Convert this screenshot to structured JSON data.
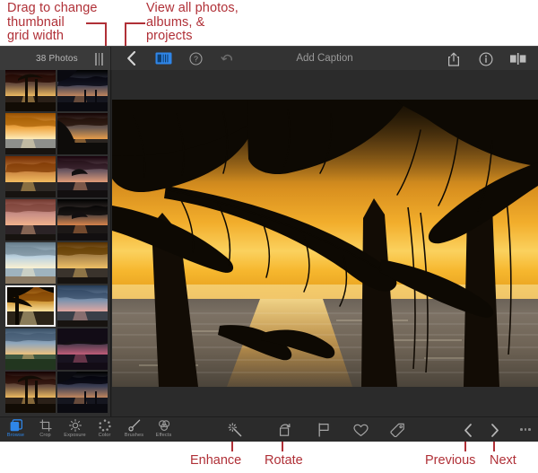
{
  "annotations": {
    "top_left": "Drag to change\nthumbnail\ngrid width",
    "top_mid": "View all photos,\nalbums, &\nprojects",
    "enhance": "Enhance",
    "rotate": "Rotate",
    "previous": "Previous",
    "next": "Next",
    "color": "#b03037"
  },
  "topbar": {
    "photo_count": "38 Photos",
    "grid_handle_name": "grid-width-drag-handle",
    "back_label": "‹",
    "view_all_label": "View All",
    "help_label": "?",
    "undo_label": "Undo",
    "caption_placeholder": "Add Caption",
    "share_label": "Share",
    "info_label": "Info",
    "compare_label": "Compare",
    "accent": "#2f86e8"
  },
  "sidebar": {
    "selected_index": 10,
    "thumbnails": [
      {
        "name": "palms-over-lagoon",
        "sky": "#6d5140",
        "sea": "#2a2018",
        "sun": "#f5c163",
        "kind": "palmshore"
      },
      {
        "name": "beach-silhouette-dusk",
        "sky": "#3b3f55",
        "sea": "#15161f",
        "sun": "#c98a5e",
        "kind": "duskbeach"
      },
      {
        "name": "sunset-over-water-bright",
        "sky": "#f0a845",
        "sea": "#8e8f8b",
        "sun": "#fff0c0",
        "kind": "brightsun"
      },
      {
        "name": "cliffside-sunset",
        "sky": "#6b5a52",
        "sea": "#2a2420",
        "sun": "#f0a24a",
        "kind": "cliff"
      },
      {
        "name": "orange-cloud-bank",
        "sky": "#c8823f",
        "sea": "#2f2a26",
        "sun": "#f6c063",
        "kind": "cloudbank"
      },
      {
        "name": "pink-clouds-horizon",
        "sky": "#6f5a63",
        "sea": "#211d22",
        "sun": "#e8a07a",
        "kind": "pinkcloud"
      },
      {
        "name": "pink-sky-shore",
        "sky": "#c98f86",
        "sea": "#2b2326",
        "sun": "#f3b48c",
        "kind": "pinkshore"
      },
      {
        "name": "dark-cloud-sunset",
        "sky": "#4a3f3c",
        "sea": "#1c1817",
        "sun": "#e0884c",
        "kind": "darkcloud"
      },
      {
        "name": "sun-on-beach",
        "sky": "#bcd2e0",
        "sea": "#9fb3be",
        "sun": "#fff4d0",
        "kind": "daybeach"
      },
      {
        "name": "golden-cloud-sea",
        "sky": "#b08a4e",
        "sea": "#3a332c",
        "sun": "#f3c468",
        "kind": "goldcloud"
      },
      {
        "name": "palm-sunset-selected",
        "sky": "#c98c28",
        "sea": "#2b2418",
        "sun": "#ffe9a8",
        "kind": "palmsun"
      },
      {
        "name": "blue-sky-pink-clouds",
        "sky": "#7d93ae",
        "sea": "#3a3f48",
        "sun": "#e8a9a0",
        "kind": "bluepink"
      },
      {
        "name": "green-shore-sunset",
        "sky": "#8fa6bd",
        "sea": "#3f5840",
        "sun": "#f2c27a",
        "kind": "greenshore"
      },
      {
        "name": "stormy-magenta-sky",
        "sky": "#46384a",
        "sea": "#181320",
        "sun": "#c8607c",
        "kind": "storm"
      }
    ]
  },
  "viewer": {
    "photo_name": "palm-trees-sunset-ocean",
    "photo_alt": "Palm tree silhouettes against a golden ocean sunset"
  },
  "bottombar": {
    "modes": [
      {
        "label": "Browse",
        "icon": "browse-icon",
        "active": true
      },
      {
        "label": "Crop",
        "icon": "crop-icon",
        "active": false
      },
      {
        "label": "Exposure",
        "icon": "exposure-icon",
        "active": false
      },
      {
        "label": "Color",
        "icon": "color-icon",
        "active": false
      },
      {
        "label": "Brushes",
        "icon": "brushes-icon",
        "active": false
      },
      {
        "label": "Effects",
        "icon": "effects-icon",
        "active": false
      }
    ],
    "edit_actions": [
      {
        "name": "enhance-button",
        "icon": "magic-wand-icon"
      },
      {
        "name": "rotate-button",
        "icon": "rotate-icon"
      },
      {
        "name": "flag-button",
        "icon": "flag-icon"
      },
      {
        "name": "favorite-button",
        "icon": "heart-icon"
      },
      {
        "name": "tag-button",
        "icon": "tag-icon"
      }
    ],
    "nav": {
      "previous_label": "‹",
      "next_label": "›",
      "more_label": "More"
    }
  }
}
